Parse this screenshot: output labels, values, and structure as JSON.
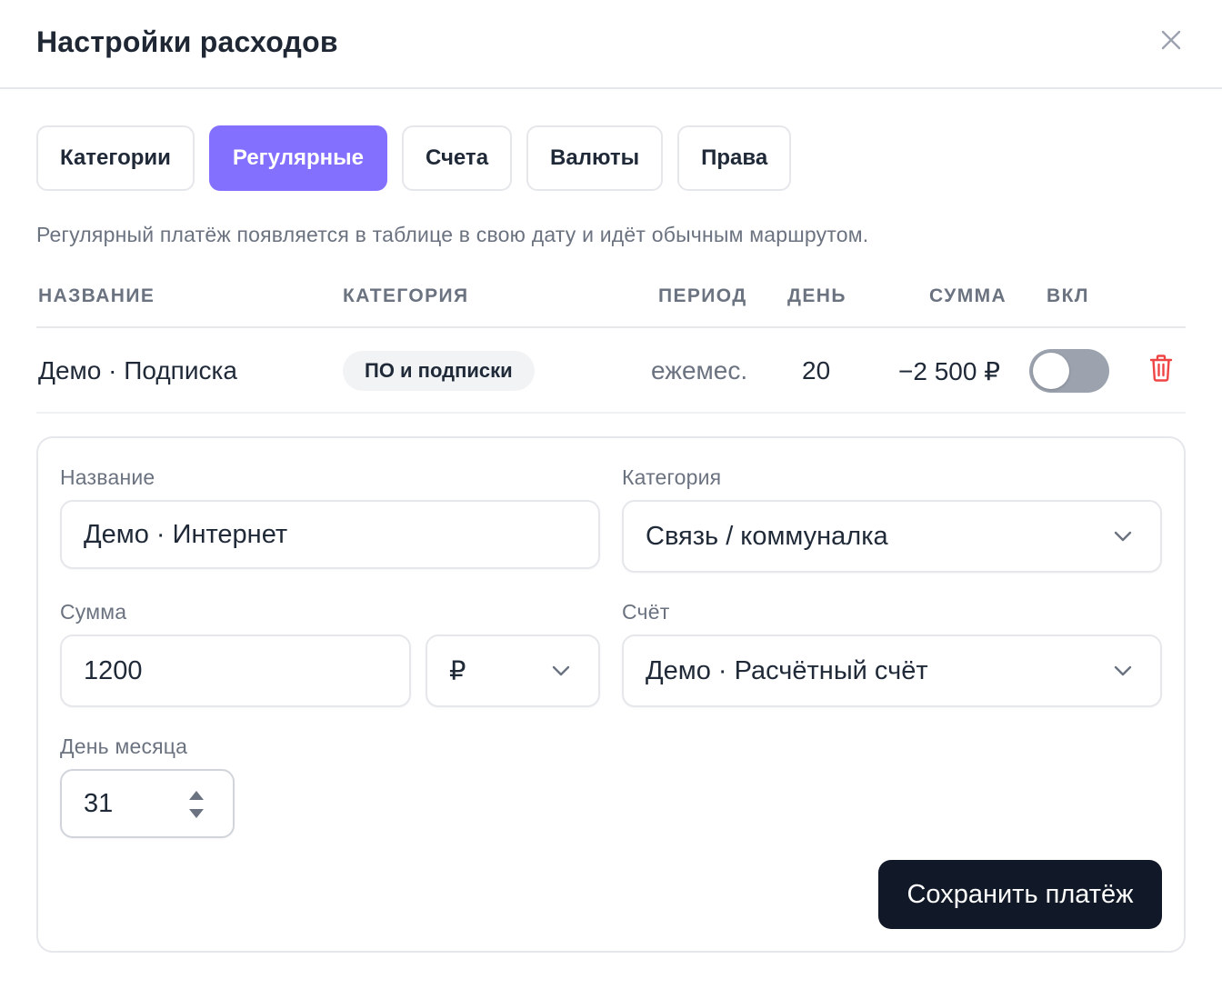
{
  "modal": {
    "title": "Настройки расходов",
    "close_icon": "close-icon"
  },
  "tabs": [
    {
      "label": "Категории",
      "active": false
    },
    {
      "label": "Регулярные",
      "active": true
    },
    {
      "label": "Счета",
      "active": false
    },
    {
      "label": "Валюты",
      "active": false
    },
    {
      "label": "Права",
      "active": false
    }
  ],
  "hint": "Регулярный платёж появляется в таблице в свою дату и идёт обычным маршрутом.",
  "table": {
    "headers": {
      "name": "НАЗВАНИЕ",
      "category": "КАТЕГОРИЯ",
      "period": "ПЕРИОД",
      "day": "ДЕНЬ",
      "amount": "СУММА",
      "enabled": "ВКЛ"
    },
    "rows": [
      {
        "name": "Демо · Подписка",
        "category": "ПО и подписки",
        "period": "ежемес.",
        "day": "20",
        "amount": "−2 500 ₽",
        "enabled": false,
        "delete_icon": "trash-icon"
      }
    ]
  },
  "form": {
    "name_label": "Название",
    "name_value": "Демо · Интернет",
    "category_label": "Категория",
    "category_value": "Связь / коммуналка",
    "amount_label": "Сумма",
    "amount_value": "1200",
    "currency_value": "₽",
    "account_label": "Счёт",
    "account_value": "Демо · Расчётный счёт",
    "day_label": "День месяца",
    "day_value": "31",
    "save_label": "Сохранить платёж"
  },
  "colors": {
    "accent": "#8470ff",
    "primary_button": "#111827",
    "danger": "#ef4444",
    "toggle_off": "#9ca3af"
  }
}
